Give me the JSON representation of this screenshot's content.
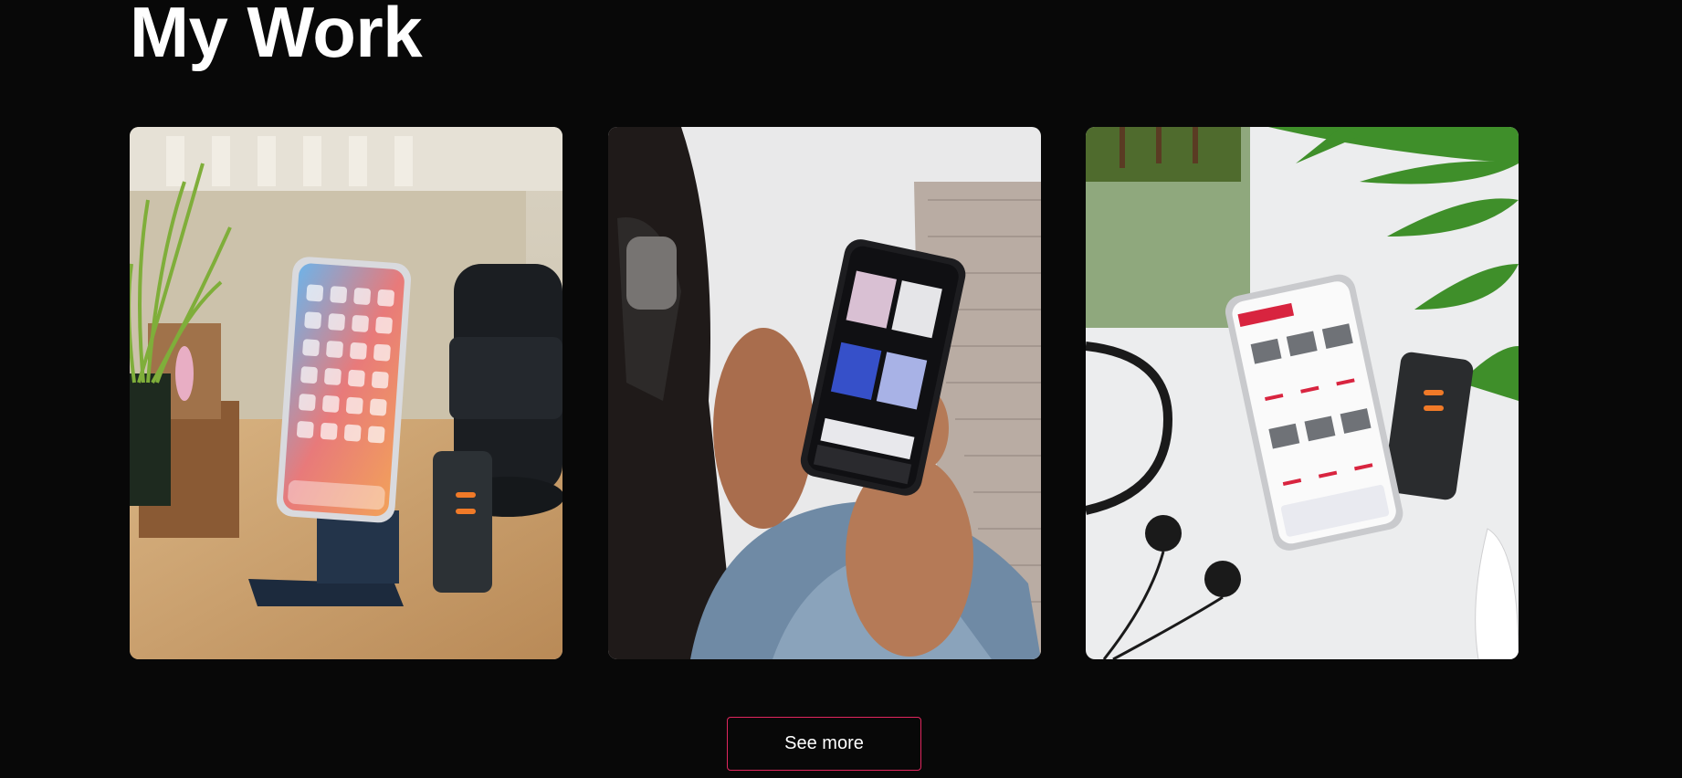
{
  "section": {
    "title": "My Work"
  },
  "projects": [
    {
      "image_icon": "phone-on-stand-photo"
    },
    {
      "image_icon": "hands-holding-phone-music-app-photo"
    },
    {
      "image_icon": "phone-store-app-with-earbuds-photo"
    }
  ],
  "actions": {
    "see_more_label": "See more"
  },
  "colors": {
    "background": "#080808",
    "text": "#ffffff",
    "button_border": "#e0265e"
  }
}
